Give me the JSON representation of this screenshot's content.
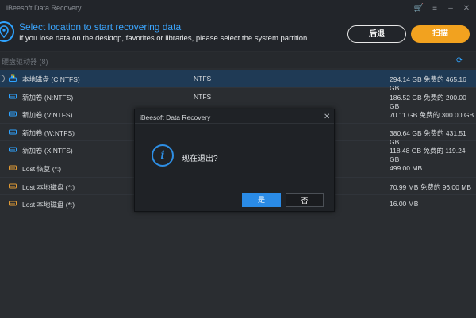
{
  "app": {
    "title": "iBeesoft Data Recovery"
  },
  "header": {
    "title": "Select location to start recovering data",
    "subtitle": "If you lose data on the desktop, favorites or libraries, please select the system partition",
    "back_label": "后退",
    "scan_label": "扫描"
  },
  "section": {
    "label": "硬盘驱动器 (8)"
  },
  "drives": [
    {
      "name": "本地磁盘 (C:NTFS)",
      "fs": "NTFS",
      "size": "294.14 GB 免费的 465.16 GB",
      "icon": "windows-drive"
    },
    {
      "name": "新加卷 (N:NTFS)",
      "fs": "NTFS",
      "size": "186.52 GB 免费的 200.00 GB",
      "icon": "drive"
    },
    {
      "name": "新加卷 (V:NTFS)",
      "fs": "",
      "size": "70.11 GB 免费的 300.00 GB",
      "icon": "drive"
    },
    {
      "name": "新加卷 (W:NTFS)",
      "fs": "",
      "size": "380.64 GB 免费的 431.51 GB",
      "icon": "drive"
    },
    {
      "name": "新加卷 (X:NTFS)",
      "fs": "",
      "size": "118.48 GB 免费的 119.24 GB",
      "icon": "drive"
    },
    {
      "name": "Lost 恢复 (*:)",
      "fs": "",
      "size": "499.00 MB",
      "icon": "lost-drive"
    },
    {
      "name": "Lost 本地磁盘 (*:)",
      "fs": "",
      "size": "70.99 MB 免费的 96.00 MB",
      "icon": "lost-drive"
    },
    {
      "name": "Lost 本地磁盘 (*:)",
      "fs": "",
      "size": "16.00 MB",
      "icon": "lost-drive"
    }
  ],
  "dialog": {
    "title": "iBeesoft Data Recovery",
    "message": "现在退出?",
    "yes_label": "是",
    "no_label": "否"
  },
  "colors": {
    "accent": "#2fa3ff",
    "scan": "#f2a21f",
    "selected_row": "#1f3a55",
    "lost_drive": "#e09a35"
  }
}
